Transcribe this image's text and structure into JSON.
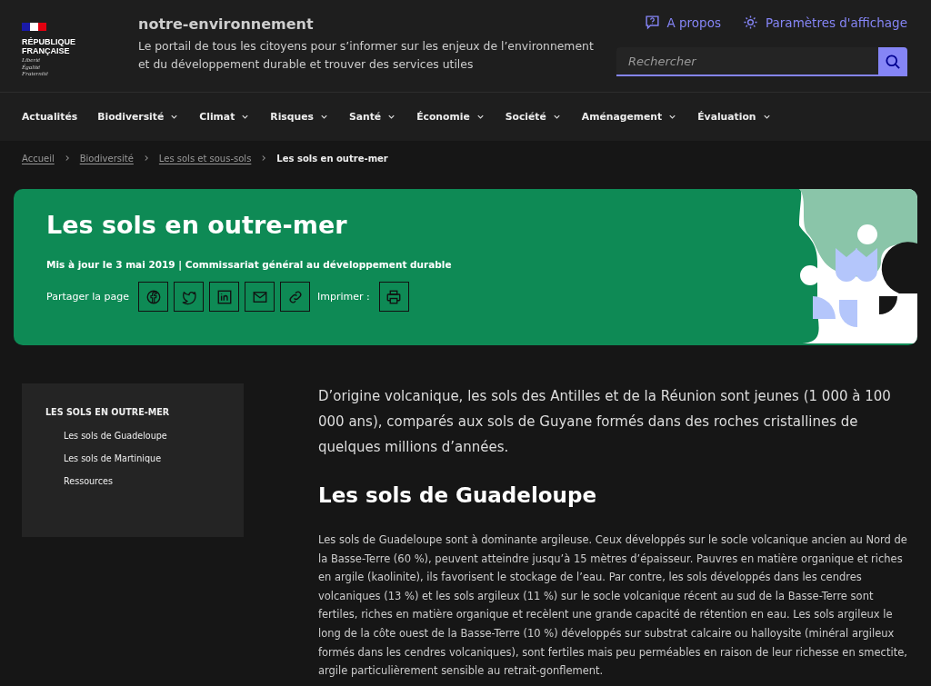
{
  "header": {
    "logo": {
      "lines": [
        "RÉPUBLIQUE",
        "FRANÇAISE"
      ],
      "motto": [
        "Liberté",
        "Égalité",
        "Fraternité"
      ]
    },
    "site_title": "notre-environnement",
    "tagline": "Le portail de tous les citoyens pour s’informer sur les enjeux de l’environnement et du développement durable et trouver des services utiles",
    "links": [
      {
        "kind": "help",
        "label": "A propos"
      },
      {
        "kind": "display",
        "label": "Paramètres d'affichage"
      }
    ],
    "search": {
      "placeholder": "Rechercher"
    }
  },
  "nav": [
    {
      "label": "Actualités",
      "has_menu": false
    },
    {
      "label": "Biodiversité",
      "has_menu": true
    },
    {
      "label": "Climat",
      "has_menu": true
    },
    {
      "label": "Risques",
      "has_menu": true
    },
    {
      "label": "Santé",
      "has_menu": true
    },
    {
      "label": "Économie",
      "has_menu": true
    },
    {
      "label": "Société",
      "has_menu": true
    },
    {
      "label": "Aménagement",
      "has_menu": true
    },
    {
      "label": "Évaluation",
      "has_menu": true
    }
  ],
  "breadcrumb": [
    {
      "label": "Accueil",
      "current": false
    },
    {
      "label": "Biodiversité",
      "current": false
    },
    {
      "label": "Les sols et sous-sols",
      "current": false
    },
    {
      "label": "Les sols en outre-mer",
      "current": true
    }
  ],
  "banner": {
    "title": "Les sols en outre-mer",
    "meta": "Mis à jour le  3 mai 2019 | Commissariat général au développement durable",
    "share_label": "Partager la page",
    "share_buttons": [
      {
        "kind": "facebook"
      },
      {
        "kind": "twitter"
      },
      {
        "kind": "linkedin"
      },
      {
        "kind": "mail"
      },
      {
        "kind": "link"
      }
    ],
    "print_label": "Imprimer :"
  },
  "sidebar": {
    "title": "LES SOLS EN OUTRE-MER",
    "items": [
      "Les sols de Guadeloupe",
      "Les sols de Martinique",
      "Ressources"
    ]
  },
  "article": {
    "intro": "D’origine volcanique, les sols des Antilles et de la Réunion sont jeunes (1 000 à 100 000 ans), comparés aux sols de Guyane formés dans des roches cristallines de quelques millions d’années.",
    "heading": "Les sols de Guadeloupe",
    "paragraph": "Les sols de Guadeloupe sont à dominante argileuse. Ceux développés sur le socle volcanique ancien au Nord de la Basse-Terre (60 %), peuvent atteindre jusqu’à 15 mètres d’épaisseur. Pauvres en matière organique et riches en argile (kaolinite), ils favorisent le stockage de l’eau. Par contre, les sols développés dans les cendres volcaniques (13 %) et les sols argileux (11 %) sur le socle volcanique récent au sud de la Basse-Terre sont fertiles, riches en matière organique et recèlent une grande capacité de rétention en eau. Les sols argileux le long de la côte ouest de la Basse-Terre (10 %) développés sur substrat calcaire ou halloysite (minéral argileux formés dans les cendres volcaniques), sont fertiles mais peu perméables en raison de leur richesse en smectite, argile particulièrement sensible au retrait-gonflement."
  }
}
